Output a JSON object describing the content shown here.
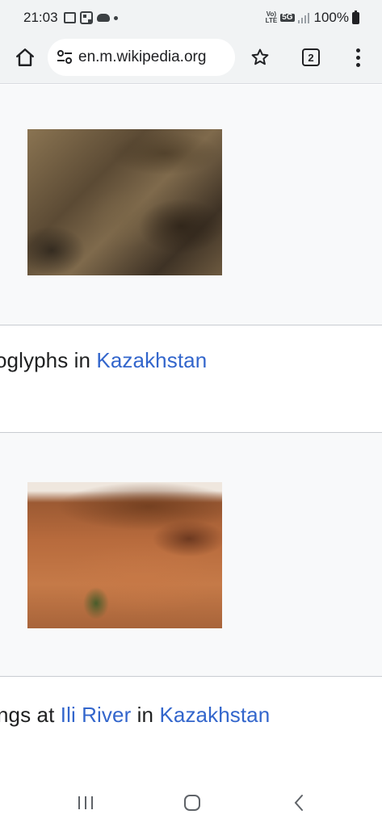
{
  "status_bar": {
    "time": "21:03",
    "battery": "100%",
    "network_label_top": "Vo)",
    "network_label_bottom": "LTE",
    "network_5g": "5G",
    "left_icons": [
      "gallery-icon",
      "qr-icon",
      "cloud-icon",
      "notification-dot-icon"
    ]
  },
  "browser": {
    "url": "en.m.wikipedia.org",
    "tab_count": "2",
    "icons": [
      "home-icon",
      "site-info-icon",
      "bookmark-star-icon",
      "tabs-icon",
      "more-menu-icon"
    ]
  },
  "gallery": {
    "items": [
      {
        "caption_prefix": "oglyphs in ",
        "caption_link": "Kazakhstan",
        "caption_suffix": ""
      },
      {
        "caption_prefix": "ngs at ",
        "caption_link": "Ili River",
        "caption_middle": " in ",
        "caption_link2": "Kazakhstan"
      }
    ]
  },
  "colors": {
    "link": "#3366cc",
    "toolbar_bg": "#f1f3f4",
    "cell_bg": "#f8f9fa",
    "border": "#c8ccd1"
  },
  "nav": {
    "icons": [
      "recent-apps-icon",
      "home-nav-icon",
      "back-icon"
    ]
  }
}
